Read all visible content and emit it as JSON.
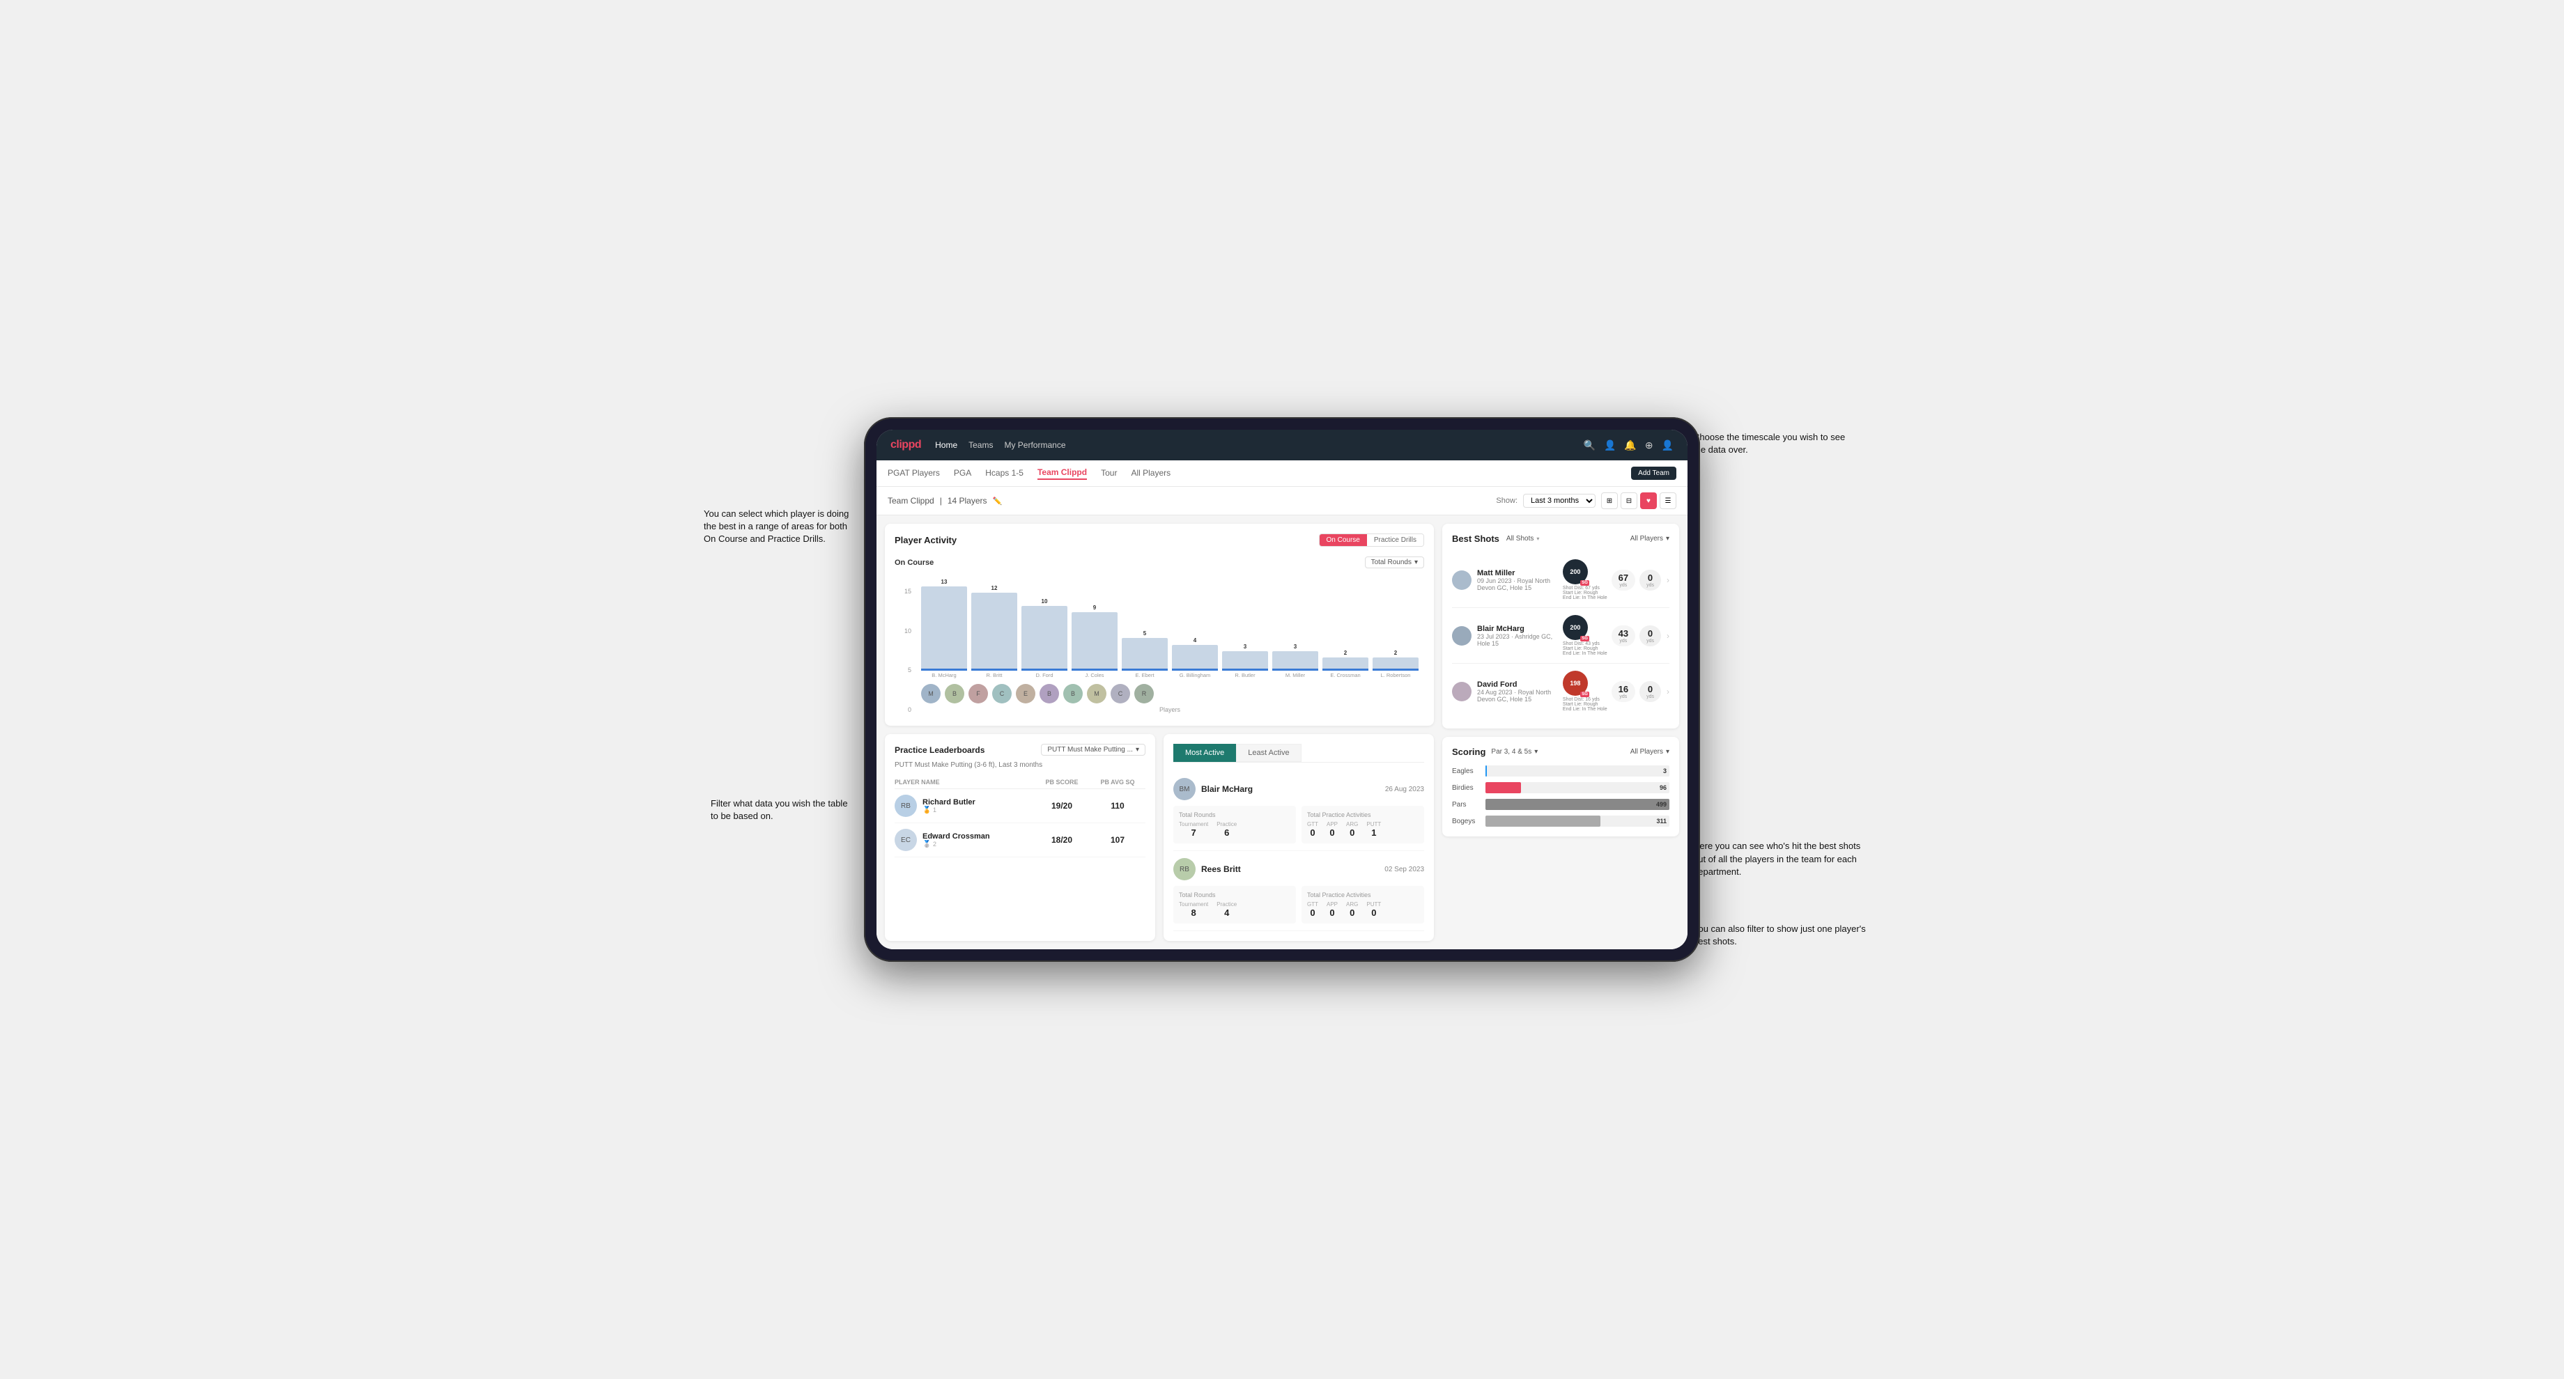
{
  "annotations": {
    "top_right": "Choose the timescale you wish to see the data over.",
    "left_top": "You can select which player is doing the best in a range of areas for both On Course and Practice Drills.",
    "left_bottom": "Filter what data you wish the table to be based on.",
    "bottom_right1": "Here you can see who's hit the best shots out of all the players in the team for each department.",
    "bottom_right2": "You can also filter to show just one player's best shots."
  },
  "nav": {
    "logo": "clippd",
    "links": [
      "Home",
      "Teams",
      "My Performance"
    ],
    "icons": [
      "search",
      "people",
      "bell",
      "plus-circle",
      "user"
    ]
  },
  "sub_nav": {
    "tabs": [
      "PGAT Players",
      "PGA",
      "Hcaps 1-5",
      "Team Clippd",
      "Tour",
      "All Players"
    ],
    "active": "Team Clippd",
    "add_btn": "Add Team"
  },
  "team_header": {
    "team_name": "Team Clippd",
    "player_count": "14 Players",
    "show_label": "Show:",
    "time_value": "Last 3 months",
    "view_options": [
      "grid4",
      "grid6",
      "heart",
      "list"
    ]
  },
  "player_activity": {
    "title": "Player Activity",
    "toggle": [
      "On Course",
      "Practice Drills"
    ],
    "active_toggle": "On Course",
    "section_title": "On Course",
    "chart_filter": "Total Rounds",
    "y_axis": [
      "15",
      "10",
      "5",
      "0"
    ],
    "bars": [
      {
        "name": "B. McHarg",
        "value": 13,
        "height": 87
      },
      {
        "name": "R. Britt",
        "value": 12,
        "height": 80
      },
      {
        "name": "D. Ford",
        "value": 10,
        "height": 67
      },
      {
        "name": "J. Coles",
        "value": 9,
        "height": 60
      },
      {
        "name": "E. Ebert",
        "value": 5,
        "height": 33
      },
      {
        "name": "G. Billingham",
        "value": 4,
        "height": 27
      },
      {
        "name": "R. Butler",
        "value": 3,
        "height": 20
      },
      {
        "name": "M. Miller",
        "value": 3,
        "height": 20
      },
      {
        "name": "E. Crossman",
        "value": 2,
        "height": 13
      },
      {
        "name": "L. Robertson",
        "value": 2,
        "height": 13
      }
    ],
    "axis_labels": {
      "y": "Total Rounds",
      "x": "Players"
    }
  },
  "practice_leaderboards": {
    "title": "Practice Leaderboards",
    "filter": "PUTT Must Make Putting ...",
    "sub_title": "PUTT Must Make Putting (3-6 ft), Last 3 months",
    "columns": [
      "PLAYER NAME",
      "PB SCORE",
      "PB AVG SQ"
    ],
    "players": [
      {
        "name": "Richard Butler",
        "rank": 1,
        "medal": "gold",
        "score": "19/20",
        "avg": "110"
      },
      {
        "name": "Edward Crossman",
        "rank": 2,
        "medal": "silver",
        "score": "18/20",
        "avg": "107"
      }
    ]
  },
  "most_active": {
    "tabs": [
      "Most Active",
      "Least Active"
    ],
    "active": "Most Active",
    "entries": [
      {
        "name": "Blair McHarg",
        "date": "26 Aug 2023",
        "total_rounds_label": "Total Rounds",
        "tournament": "7",
        "practice": "6",
        "total_practice_label": "Total Practice Activities",
        "gtt": "0",
        "app": "0",
        "arg": "0",
        "putt": "1"
      },
      {
        "name": "Rees Britt",
        "date": "02 Sep 2023",
        "total_rounds_label": "Total Rounds",
        "tournament": "8",
        "practice": "4",
        "total_practice_label": "Total Practice Activities",
        "gtt": "0",
        "app": "0",
        "arg": "0",
        "putt": "0"
      }
    ]
  },
  "best_shots": {
    "title": "Best Shots",
    "filter": "All Shots",
    "players_filter": "All Players",
    "shots": [
      {
        "player": "Matt Miller",
        "date": "09 Jun 2023",
        "course": "Royal North Devon GC",
        "hole": "Hole 15",
        "badge_val": "200",
        "badge_label": "SG",
        "shot_dist": "Shot Dist: 67 yds",
        "start_lie": "Start Lie: Rough",
        "end_lie": "End Lie: In The Hole",
        "stat1_val": "67",
        "stat1_unit": "yds",
        "stat2_val": "0",
        "stat2_unit": "yds"
      },
      {
        "player": "Blair McHarg",
        "date": "23 Jul 2023",
        "course": "Ashridge GC",
        "hole": "Hole 15",
        "badge_val": "200",
        "badge_label": "SG",
        "shot_dist": "Shot Dist: 43 yds",
        "start_lie": "Start Lie: Rough",
        "end_lie": "End Lie: In The Hole",
        "stat1_val": "43",
        "stat1_unit": "yds",
        "stat2_val": "0",
        "stat2_unit": "yds"
      },
      {
        "player": "David Ford",
        "date": "24 Aug 2023",
        "course": "Royal North Devon GC",
        "hole": "Hole 15",
        "badge_val": "198",
        "badge_label": "SG",
        "shot_dist": "Shot Dist: 16 yds",
        "start_lie": "Start Lie: Rough",
        "end_lie": "End Lie: In The Hole",
        "stat1_val": "16",
        "stat1_unit": "yds",
        "stat2_val": "0",
        "stat2_unit": "yds"
      }
    ]
  },
  "scoring": {
    "title": "Scoring",
    "filter": "Par 3, 4 & 5s",
    "players_filter": "All Players",
    "rows": [
      {
        "label": "Eagles",
        "value": 3,
        "max": 499,
        "color": "#2196F3"
      },
      {
        "label": "Birdies",
        "value": 96,
        "max": 499,
        "color": "#e94560"
      },
      {
        "label": "Pars",
        "value": 499,
        "max": 499,
        "color": "#888"
      },
      {
        "label": "Bogeys",
        "value": 311,
        "max": 499,
        "color": "#aaa"
      }
    ]
  },
  "colors": {
    "primary": "#e94560",
    "dark": "#1e2a35",
    "accent": "#3a7bd5"
  }
}
